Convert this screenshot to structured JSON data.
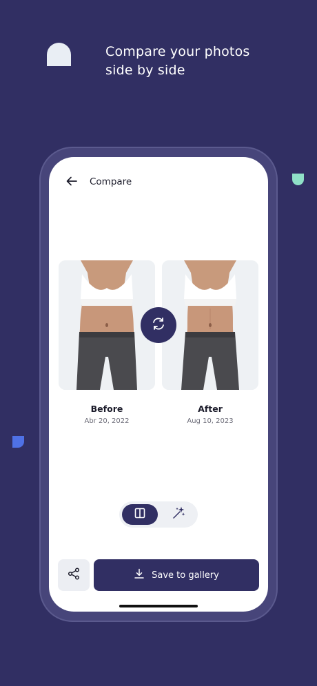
{
  "promo": {
    "headline_line1": "Compare your photos",
    "headline_line2": "side by side"
  },
  "header": {
    "title": "Compare",
    "back_icon": "arrow-left-icon"
  },
  "photos": [
    {
      "label": "Before",
      "date": "Abr 20, 2022"
    },
    {
      "label": "After",
      "date": "Aug 10, 2023"
    }
  ],
  "swap_icon": "refresh-icon",
  "view_modes": [
    {
      "icon": "split-view-icon",
      "selected": true
    },
    {
      "icon": "magic-wand-icon",
      "selected": false
    }
  ],
  "actions": {
    "share_icon": "share-icon",
    "save_label": "Save to gallery",
    "save_icon": "download-icon"
  },
  "colors": {
    "background": "#312f63",
    "accent": "#312f63",
    "green_shape": "#8fe0c7",
    "blue_shape": "#4f71e5"
  }
}
